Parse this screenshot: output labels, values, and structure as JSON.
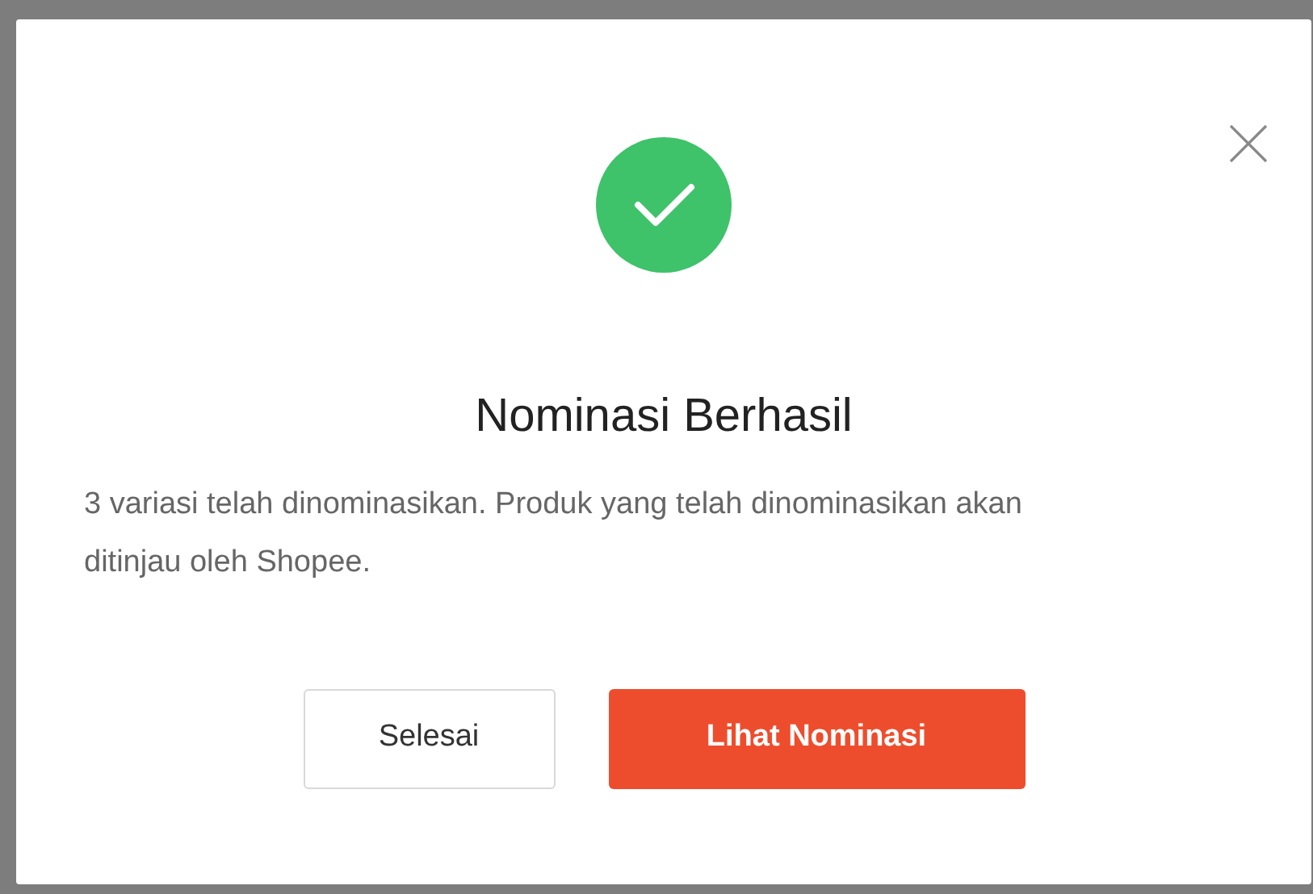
{
  "dialog": {
    "title": "Nominasi Berhasil",
    "message": "3 variasi telah dinominasikan. Produk yang telah dinominasikan akan ditinjau oleh Shopee.",
    "buttons": [
      {
        "label": "Selesai",
        "kind": "secondary"
      },
      {
        "label": "Lihat Nominasi",
        "kind": "primary"
      }
    ]
  }
}
